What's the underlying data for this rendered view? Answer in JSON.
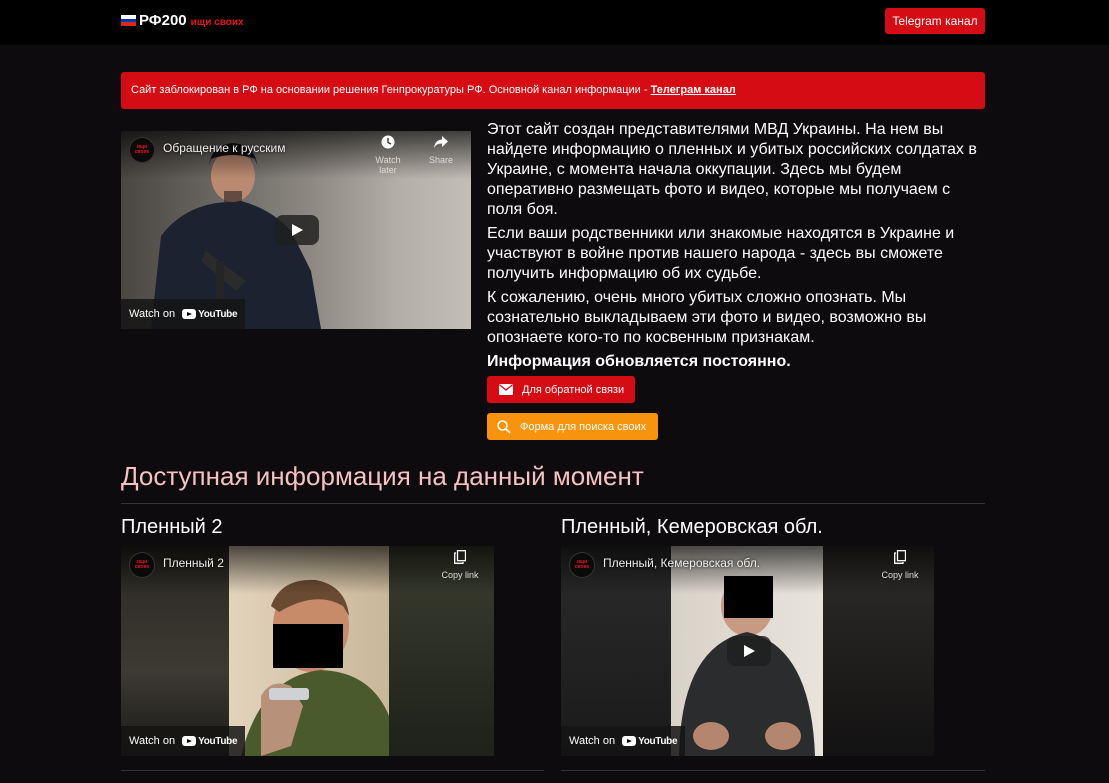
{
  "header": {
    "brand_name": "РФ200",
    "brand_tag": "ищи своих",
    "telegram_button": "Telegram канал",
    "flag_colors": [
      "#ffffff",
      "#0039a6",
      "#d52b1e"
    ]
  },
  "alert": {
    "text": "Сайт заблокирован в РФ на основании решения Генпрокуратуры РФ. Основной канал информации - ",
    "link_text": "Телеграм канал",
    "color": "#d50c13"
  },
  "main_video": {
    "title": "Обращение к русским",
    "channel_badge": "ищи своих",
    "watch_later": "Watch later",
    "share": "Share",
    "watch_on": "Watch on",
    "youtube": "YouTube"
  },
  "intro": {
    "p1": "Этот сайт создан представителями МВД Украины. На нем вы найдете информацию о пленных и убитых российских солдатах в Украине, с момента начала оккупации. Здесь мы будем оперативно размещать фото и видео, которые мы получаем с поля боя.",
    "p2": "Если ваши родственники или знакомые находятся в Украине и участвуют в войне против нашего народа - здесь вы сможете получить информацию об их судьбе.",
    "p3": "К сожалению, очень много убитых сложно опознать. Мы сознательно выкладываем эти фото и видео, возможно вы опознаете кого-то по косвенным признакам.",
    "p4": "Информация обновляется постоянно."
  },
  "buttons": {
    "feedback": "Для обратной связи",
    "search_form": "Форма для поиска своих",
    "feedback_color": "#d50c13",
    "search_color": "#f7930c"
  },
  "section": {
    "title": "Доступная информация на данный момент"
  },
  "cards": [
    {
      "title": "Пленный 2",
      "video_title": "Пленный 2",
      "copy_link": "Copy link",
      "watch_on": "Watch on",
      "youtube": "YouTube"
    },
    {
      "title": "Пленный, Кемеровская обл.",
      "video_title": "Пленный, Кемеровская обл.",
      "copy_link": "Copy link",
      "watch_on": "Watch on",
      "youtube": "YouTube"
    }
  ]
}
